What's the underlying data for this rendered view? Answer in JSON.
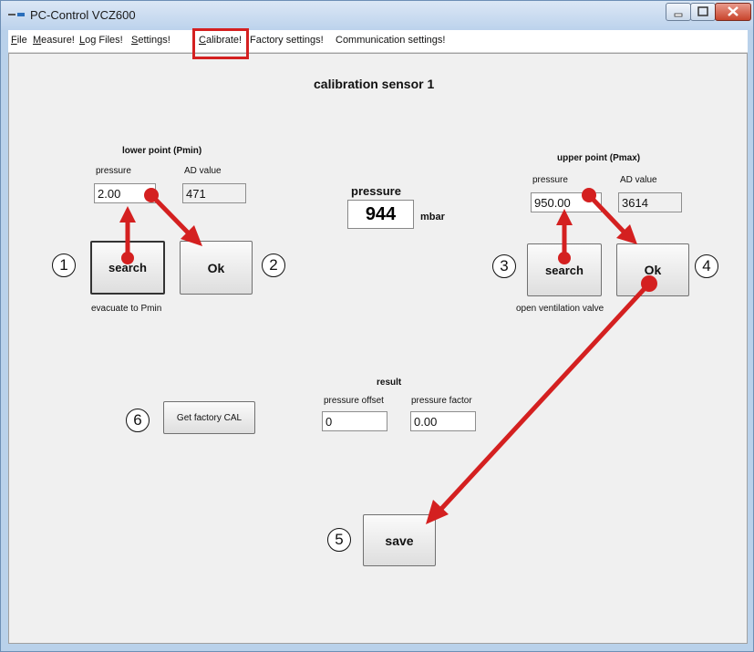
{
  "window": {
    "title": "PC-Control VCZ600"
  },
  "menu": [
    {
      "label": "File",
      "accel": "F"
    },
    {
      "label": "Measure!",
      "accel": "M"
    },
    {
      "label": "Log Files!",
      "accel": "L"
    },
    {
      "label": "Settings!",
      "accel": "S"
    },
    {
      "label": "Calibrate!",
      "accel": "C"
    },
    {
      "label": "Factory settings!",
      "accel": ""
    },
    {
      "label": "Communication settings!",
      "accel": ""
    }
  ],
  "form": {
    "heading": "calibration sensor 1",
    "lower": {
      "title": "lower point (Pmin)",
      "pressure_label": "pressure",
      "pressure_value": "2.00",
      "ad_label": "AD value",
      "ad_value": "471",
      "search_label": "search",
      "ok_label": "Ok",
      "hint": "evacuate to Pmin"
    },
    "upper": {
      "title": "upper point (Pmax)",
      "pressure_label": "pressure",
      "pressure_value": "950.00",
      "ad_label": "AD value",
      "ad_value": "3614",
      "search_label": "search",
      "ok_label": "Ok",
      "hint": "open ventilation valve"
    },
    "current": {
      "label": "pressure",
      "value": "944",
      "unit": "mbar"
    },
    "result": {
      "title": "result",
      "offset_label": "pressure offset",
      "offset_value": "0",
      "factor_label": "pressure factor",
      "factor_value": "0.00"
    },
    "factory_button": "Get factory CAL",
    "save_button": "save"
  },
  "callouts": [
    "1",
    "2",
    "3",
    "4",
    "5",
    "6"
  ],
  "colors": {
    "annotation": "#d42020",
    "titlebar": "#bcd2ec",
    "client_bg": "#f0f0f0"
  }
}
